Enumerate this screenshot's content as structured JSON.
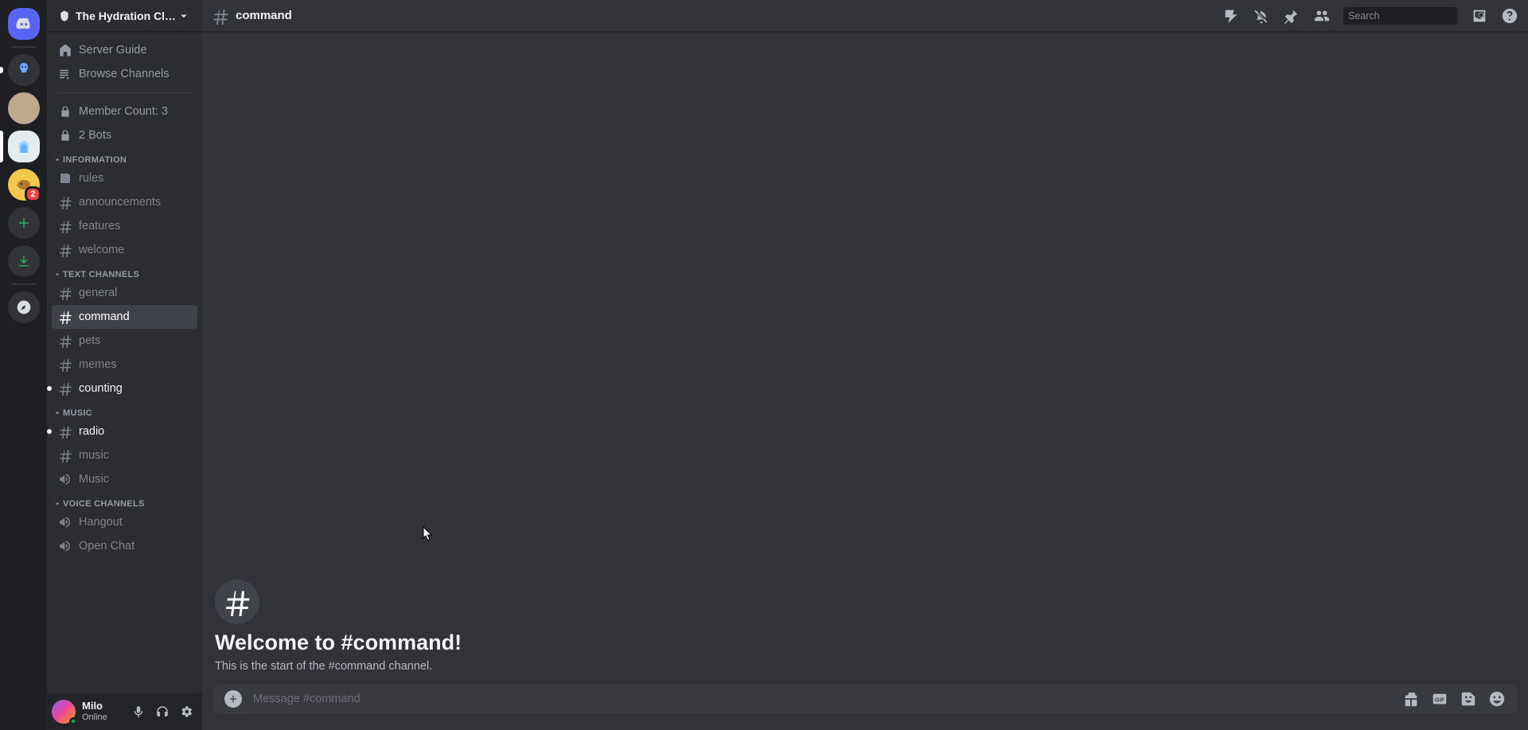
{
  "server": {
    "name": "The Hydration Club"
  },
  "server_list": {
    "badge": "2"
  },
  "nav": {
    "server_guide": "Server Guide",
    "browse_channels": "Browse Channels",
    "member_count": "Member Count: 3",
    "bots": "2 Bots"
  },
  "categories": [
    {
      "name": "INFORMATION",
      "channels": [
        {
          "name": "rules",
          "icon": "rules"
        },
        {
          "name": "announcements",
          "icon": "hash"
        },
        {
          "name": "features",
          "icon": "hash"
        },
        {
          "name": "welcome",
          "icon": "hash"
        }
      ]
    },
    {
      "name": "TEXT CHANNELS",
      "channels": [
        {
          "name": "general",
          "icon": "hash"
        },
        {
          "name": "command",
          "icon": "hash",
          "selected": true
        },
        {
          "name": "pets",
          "icon": "hash"
        },
        {
          "name": "memes",
          "icon": "hash"
        },
        {
          "name": "counting",
          "icon": "hash",
          "unread": true
        }
      ]
    },
    {
      "name": "MUSIC",
      "channels": [
        {
          "name": "radio",
          "icon": "hash",
          "unread": true
        },
        {
          "name": "music",
          "icon": "hash"
        },
        {
          "name": "Music",
          "icon": "speaker"
        }
      ]
    },
    {
      "name": "VOICE CHANNELS",
      "channels": [
        {
          "name": "Hangout",
          "icon": "speaker"
        },
        {
          "name": "Open Chat",
          "icon": "speaker"
        }
      ]
    }
  ],
  "user": {
    "name": "Milo",
    "status": "Online"
  },
  "channel": {
    "name": "command",
    "welcome_title": "Welcome to #command!",
    "welcome_sub": "This is the start of the #command channel."
  },
  "composer": {
    "placeholder": "Message #command"
  },
  "search": {
    "placeholder": "Search"
  }
}
